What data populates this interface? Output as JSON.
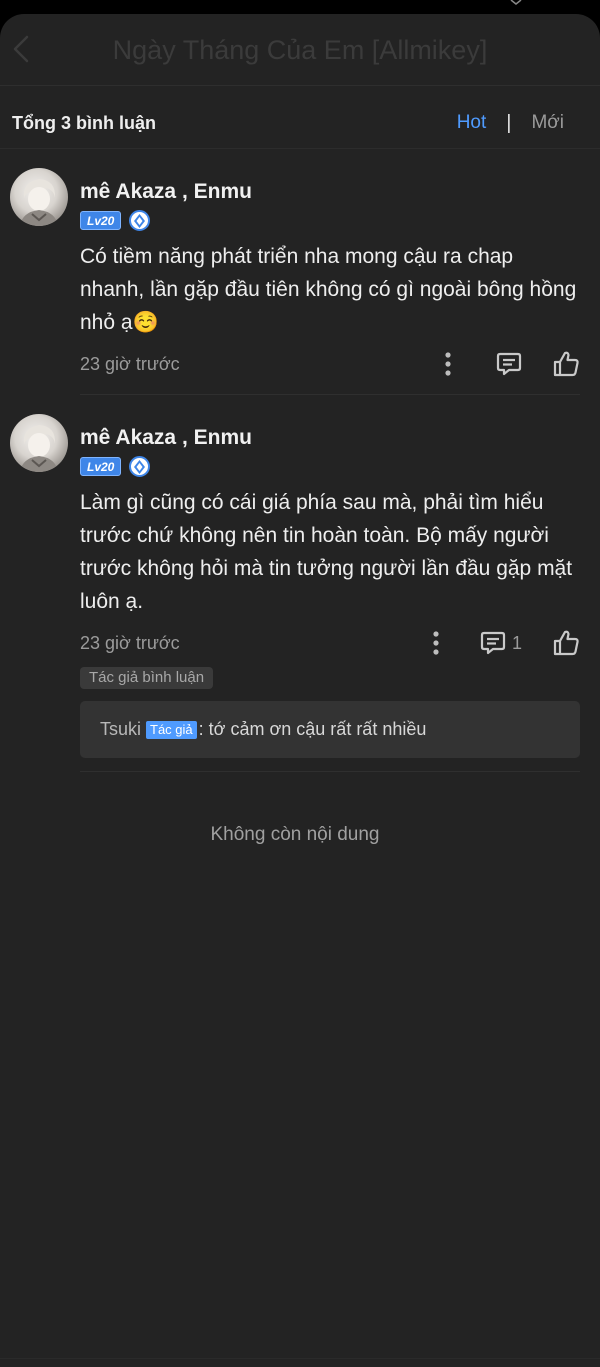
{
  "background_title": "Ngày Tháng Của Em [Allmikey]",
  "header": {
    "total_label": "Tổng 3 bình luận",
    "sort_hot": "Hot",
    "sort_separator": "|",
    "sort_new": "Mới"
  },
  "colors": {
    "accent": "#4f9bff",
    "sheet_bg": "#232323",
    "level_badge": "#3f86e8"
  },
  "comments": [
    {
      "username": "mê Akaza , Enmu",
      "level": "Lv20",
      "text": "Có tiềm năng phát triển nha mong cậu ra chap nhanh, lần gặp đầu tiên không có gì ngoài bông hồng nhỏ ạ☺️",
      "time": "23 giờ trước",
      "reply_count": ""
    },
    {
      "username": "mê Akaza , Enmu",
      "level": "Lv20",
      "text": "Làm gì cũng có cái giá phía sau mà, phải tìm hiểu trước chứ không nên tin hoàn toàn. Bộ mấy người trước không hỏi mà tin tưởng người lần đầu gặp mặt luôn ạ.",
      "time": "23 giờ trước",
      "reply_count": "1",
      "author_tag": "Tác giả bình luận",
      "reply": {
        "name": "Tsuki",
        "tag": "Tác giả",
        "text": ": tớ cảm ơn cậu rất rất nhiều"
      }
    }
  ],
  "footer_note": "Không còn nội dung"
}
